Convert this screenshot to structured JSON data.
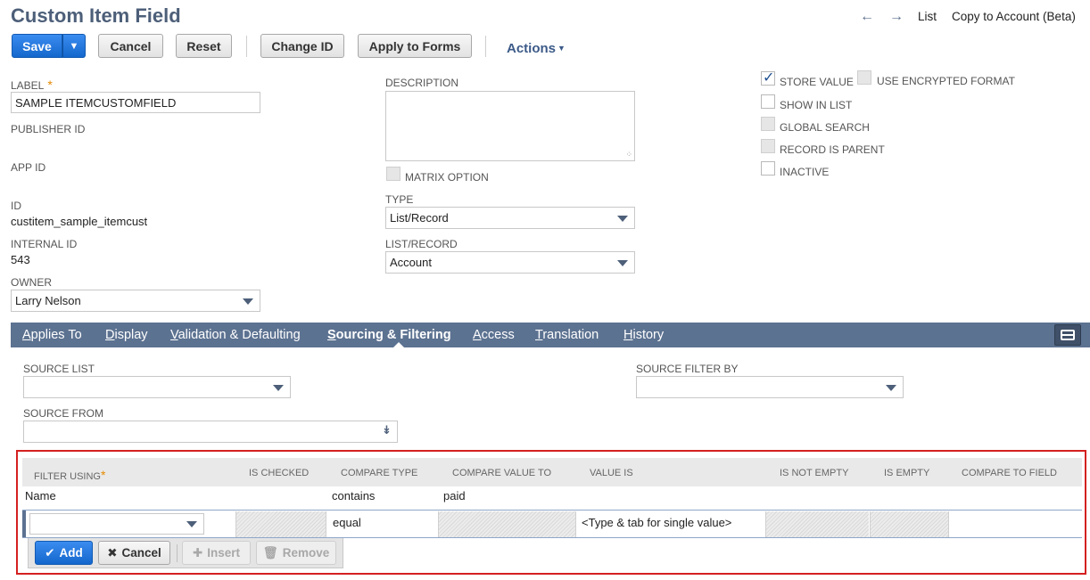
{
  "header": {
    "title": "Custom Item Field",
    "nav": {
      "back_icon": "arrow-left-icon",
      "forward_icon": "arrow-right-icon",
      "list_label": "List",
      "copy_label": "Copy to Account (Beta)"
    }
  },
  "toolbar": {
    "save_label": "Save",
    "save_menu_glyph": "▼",
    "cancel_label": "Cancel",
    "reset_label": "Reset",
    "change_id_label": "Change ID",
    "apply_to_forms_label": "Apply to Forms",
    "actions_label": "Actions",
    "actions_caret": "▼"
  },
  "fields": {
    "label": {
      "label": "Label",
      "required_mark": "*",
      "value": "SAMPLE ITEMCUSTOMFIELD"
    },
    "publisher_id": {
      "label": "Publisher ID"
    },
    "app_id": {
      "label": "App ID"
    },
    "id": {
      "label": "ID",
      "value": "custitem_sample_itemcust"
    },
    "internal_id": {
      "label": "Internal ID",
      "value": "543"
    },
    "owner": {
      "label": "Owner",
      "value": "Larry Nelson"
    },
    "description": {
      "label": "Description",
      "value": ""
    },
    "matrix_option": {
      "label": "Matrix Option",
      "checked": false,
      "disabled": true
    },
    "type": {
      "label": "Type",
      "value": "List/Record"
    },
    "list_record": {
      "label": "List/Record",
      "value": "Account"
    }
  },
  "checkboxes": {
    "store_value": {
      "label": "Store Value",
      "checked": true,
      "disabled": false
    },
    "use_encrypted_format": {
      "label": "Use Encrypted Format",
      "checked": false,
      "disabled": true
    },
    "show_in_list": {
      "label": "Show in List",
      "checked": false,
      "disabled": false
    },
    "global_search": {
      "label": "Global Search",
      "checked": false,
      "disabled": true
    },
    "record_is_parent": {
      "label": "Record is Parent",
      "checked": false,
      "disabled": true
    },
    "inactive": {
      "label": "Inactive",
      "checked": false,
      "disabled": false
    }
  },
  "tabs": [
    {
      "first": "A",
      "rest": "pplies To",
      "active": false
    },
    {
      "first": "D",
      "rest": "isplay",
      "active": false
    },
    {
      "first": "V",
      "rest": "alidation & Defaulting",
      "active": false
    },
    {
      "first": "S",
      "rest": "ourcing & Filtering",
      "active": true
    },
    {
      "first": "A",
      "rest": "ccess",
      "active": false
    },
    {
      "first": "T",
      "rest": "ranslation",
      "active": false
    },
    {
      "first": "H",
      "rest": "istory",
      "active": false
    }
  ],
  "sourcing": {
    "source_list": {
      "label": "Source List",
      "value": ""
    },
    "source_from": {
      "label": "Source From",
      "value": ""
    },
    "source_filter_by": {
      "label": "Source Filter By",
      "value": ""
    }
  },
  "filter_grid": {
    "columns": [
      "Filter Using",
      "Is Checked",
      "Compare Type",
      "Compare Value To",
      "Value Is",
      "Is Not Empty",
      "Is Empty",
      "Compare to Field"
    ],
    "required_mark": "*",
    "rows": [
      {
        "filter_using": "Name",
        "is_checked": "",
        "compare_type": "contains",
        "compare_value_to": "paid",
        "value_is": "",
        "is_not_empty": "",
        "is_empty": "",
        "compare_to_field": ""
      }
    ],
    "edit_row": {
      "filter_using": "",
      "compare_type": "equal",
      "value_is": "<Type & tab for single value>"
    },
    "buttons": {
      "add": "Add",
      "cancel": "Cancel",
      "insert": "Insert",
      "remove": "Remove"
    }
  },
  "colors": {
    "accent_blue": "#1467cc",
    "tab_bar": "#5c7291",
    "title": "#4d5f79",
    "highlight_frame": "#d42020",
    "required": "#e58a00"
  }
}
